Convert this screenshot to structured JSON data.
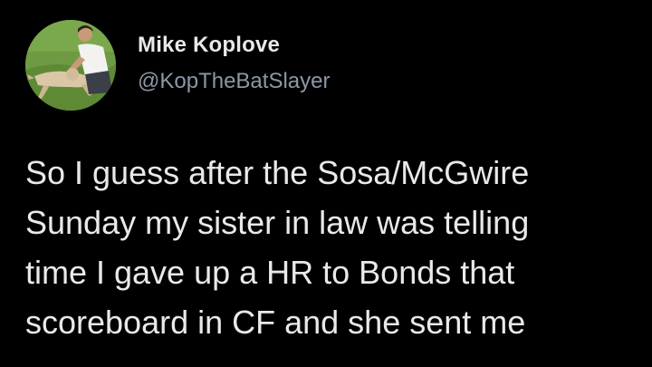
{
  "author": {
    "display_name": "Mike Koplove",
    "handle": "@KopTheBatSlayer",
    "avatar_icon": "profile-photo"
  },
  "tweet": {
    "lines": [
      "So I guess after the Sosa/McGwire",
      "Sunday my sister in law was telling",
      "time I gave up a HR to Bonds that",
      "scoreboard in CF and she sent me"
    ]
  },
  "colors": {
    "background": "#000000",
    "text": "#e7e9ea",
    "handle_text": "#8b98a5"
  }
}
